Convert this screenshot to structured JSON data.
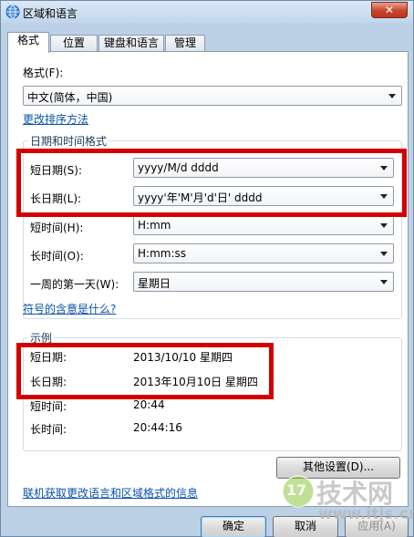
{
  "window": {
    "title": "区域和语言",
    "close_label": "✕"
  },
  "tabs": [
    {
      "label": "格式",
      "active": true
    },
    {
      "label": "位置",
      "active": false
    },
    {
      "label": "键盘和语言",
      "active": false
    },
    {
      "label": "管理",
      "active": false
    }
  ],
  "format": {
    "label": "格式(F):",
    "value": "中文(简体，中国)",
    "sort_link": "更改排序方法"
  },
  "datetime": {
    "group_title": "日期和时间格式",
    "short_date": {
      "label": "短日期(S):",
      "value": "yyyy/M/d dddd"
    },
    "long_date": {
      "label": "长日期(L):",
      "value": "yyyy'年'M'月'd'日' dddd"
    },
    "short_time": {
      "label": "短时间(H):",
      "value": "H:mm"
    },
    "long_time": {
      "label": "长时间(O):",
      "value": "H:mm:ss"
    },
    "first_day": {
      "label": "一周的第一天(W):",
      "value": "星期日"
    },
    "symbols_link": "符号的含意是什么?"
  },
  "examples": {
    "group_title": "示例",
    "rows": [
      {
        "label": "短日期:",
        "value": "2013/10/10 星期四"
      },
      {
        "label": "长日期:",
        "value": "2013年10月10日 星期四"
      },
      {
        "label": "短时间:",
        "value": "20:44"
      },
      {
        "label": "长时间:",
        "value": "20:44:16"
      }
    ]
  },
  "other_settings_label": "其他设置(D)...",
  "online_link": "联机获取更改语言和区域格式的信息",
  "buttons": {
    "ok": "确定",
    "cancel": "取消",
    "apply": "应用(A)"
  },
  "watermark": {
    "badge": "17",
    "brand": "技术网",
    "url": "www.itjs.cn"
  },
  "colors": {
    "highlight_red": "#d40000",
    "link_blue": "#0a52a8"
  }
}
